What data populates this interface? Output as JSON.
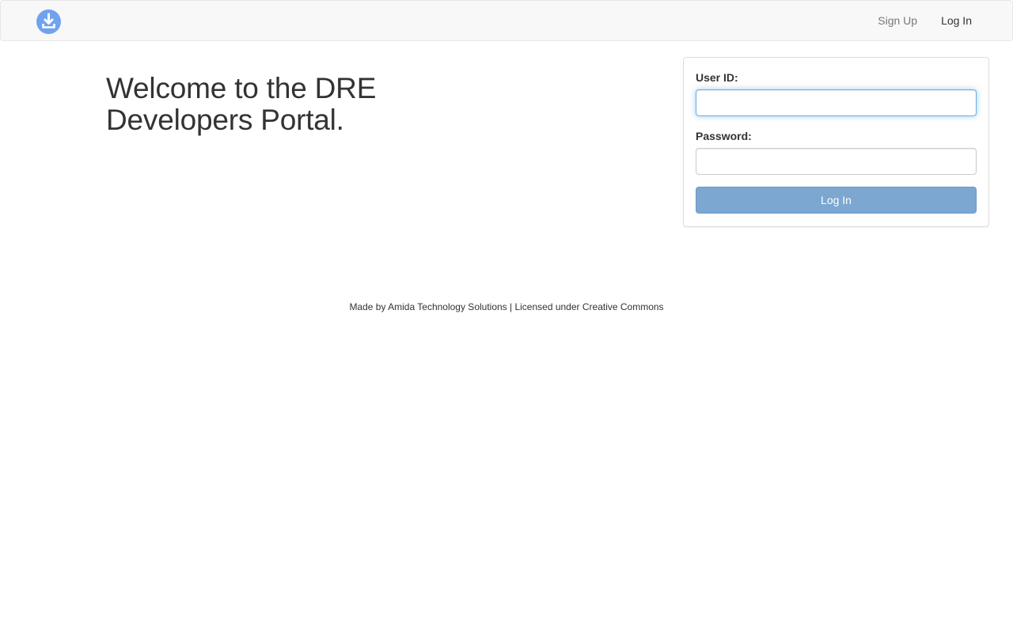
{
  "header": {
    "logo_icon": "download-icon",
    "nav": {
      "signup_label": "Sign Up",
      "login_label": "Log In"
    }
  },
  "main": {
    "welcome_title": "Welcome to the DRE Developers Portal."
  },
  "login_form": {
    "user_id_label": "User ID:",
    "user_id_value": "",
    "password_label": "Password:",
    "password_value": "",
    "submit_label": "Log In"
  },
  "footer": {
    "text": "Made by Amida Technology Solutions | Licensed under Creative Commons"
  },
  "colors": {
    "brand_blue": "#6fa3f0",
    "button_blue": "#7ba7d1",
    "navbar_bg": "#f8f8f8",
    "focus_border": "#66afe9"
  }
}
